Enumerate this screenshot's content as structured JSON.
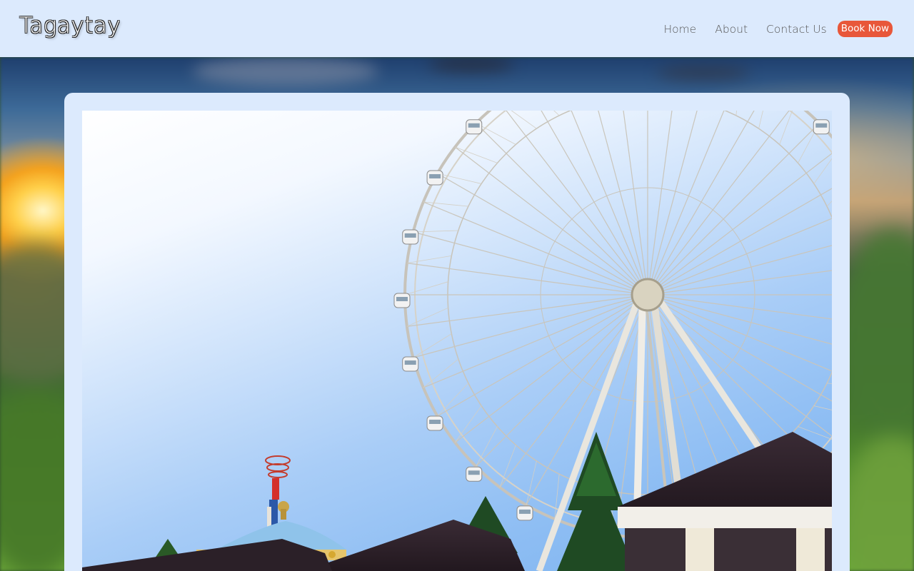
{
  "header": {
    "logo": "Tagaytay",
    "nav": [
      {
        "label": "Home"
      },
      {
        "label": "About"
      },
      {
        "label": "Contact Us"
      }
    ],
    "book_button": "Book Now"
  },
  "colors": {
    "header_bg": "#dceafd",
    "accent": "#e8573a",
    "nav_text": "#575757"
  },
  "hero": {
    "image": "ferris-wheel-photo"
  }
}
